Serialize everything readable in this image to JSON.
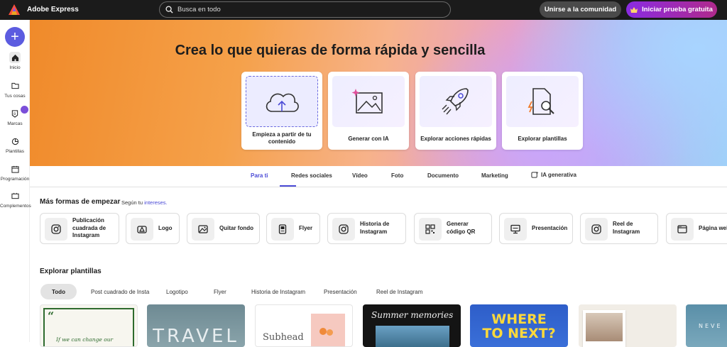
{
  "topbar": {
    "brand": "Adobe Express",
    "search_placeholder": "Busca en todo",
    "community_label": "Unirse a la comunidad",
    "trial_label": "Iniciar prueba gratuita"
  },
  "sidebar": {
    "items": [
      {
        "label": "Inicio",
        "icon": "home-icon"
      },
      {
        "label": "Tus cosas",
        "icon": "folder-icon"
      },
      {
        "label": "Marcas",
        "icon": "brand-icon"
      },
      {
        "label": "Plantillas",
        "icon": "templates-icon"
      },
      {
        "label": "Programación",
        "icon": "calendar-icon"
      },
      {
        "label": "Complementos",
        "icon": "addons-icon"
      }
    ]
  },
  "hero": {
    "title": "Crea lo que quieras de forma rápida y sencilla",
    "cards": [
      {
        "label": "Empieza a partir de tu contenido",
        "icon": "cloud-upload-icon"
      },
      {
        "label": "Generar con IA",
        "icon": "sparkle-image-icon"
      },
      {
        "label": "Explorar acciones rápidas",
        "icon": "rocket-icon"
      },
      {
        "label": "Explorar plantillas",
        "icon": "search-file-icon"
      }
    ]
  },
  "tabs": [
    "Para ti",
    "Redes sociales",
    "Vídeo",
    "Foto",
    "Documento",
    "Marketing",
    "IA generativa"
  ],
  "more": {
    "title": "Más formas de empezar",
    "sub_prefix": "Según tu ",
    "sub_link": "intereses."
  },
  "quick_actions": [
    {
      "label": "Publicación cuadrada de Instagram",
      "icon": "instagram-icon"
    },
    {
      "label": "Logo",
      "icon": "logo-icon"
    },
    {
      "label": "Quitar fondo",
      "icon": "remove-background-icon"
    },
    {
      "label": "Flyer",
      "icon": "flyer-icon"
    },
    {
      "label": "Historia de Instagram",
      "icon": "instagram-icon"
    },
    {
      "label": "Generar código QR",
      "icon": "qr-code-icon"
    },
    {
      "label": "Presentación",
      "icon": "presentation-icon"
    },
    {
      "label": "Reel de Instagram",
      "icon": "instagram-icon"
    },
    {
      "label": "Página web",
      "icon": "webpage-icon"
    }
  ],
  "explore": {
    "title": "Explorar plantillas",
    "chips": [
      "Todo",
      "Post cuadrado de Insta",
      "Logotipo",
      "Flyer",
      "Historia de Instagram",
      "Presentación",
      "Reel de Instagram"
    ],
    "templates": [
      {
        "text": "If we can change our"
      },
      {
        "text": "TRAVEL"
      },
      {
        "text": "Subhead"
      },
      {
        "text": "Summer memories"
      },
      {
        "text": "WHERE TO NEXT?"
      },
      {
        "text": ""
      },
      {
        "text": "NEVE"
      }
    ]
  }
}
